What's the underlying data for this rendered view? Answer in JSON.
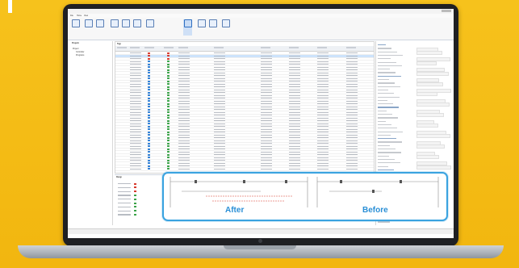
{
  "app": {
    "window_title": "",
    "menu_items": [
      "File",
      "Home",
      "View"
    ]
  },
  "ribbon": {
    "buttons": [
      {
        "icon": "new-icon"
      },
      {
        "icon": "open-icon"
      },
      {
        "icon": "save-icon"
      },
      {
        "icon": "compare-icon"
      },
      {
        "icon": "import-icon"
      },
      {
        "icon": "export-icon"
      },
      {
        "icon": "filter-icon"
      },
      {
        "icon": "diagram-icon",
        "active": true
      },
      {
        "icon": "settings-icon"
      },
      {
        "icon": "report-icon"
      },
      {
        "icon": "help-icon"
      }
    ]
  },
  "left_panel": {
    "title": "Projects",
    "tree": [
      "Project",
      "Controller",
      "Programs"
    ]
  },
  "grid": {
    "title": "Tags",
    "selected_row": 1,
    "row_count": 42,
    "status_colors": [
      "#d83a2e",
      "#2f7fd6",
      "#2f7fd6",
      "#3aa348"
    ]
  },
  "bottom_panel": {
    "title": "Rungs"
  },
  "callout": {
    "after_label": "After",
    "before_label": "Before",
    "accent": "#3aa3e0"
  },
  "colors": {
    "background": "#f4bd17",
    "laptop_frame": "#1f2023",
    "highlight_row": "#cde3fb",
    "diff_red": "#d83a2e"
  }
}
